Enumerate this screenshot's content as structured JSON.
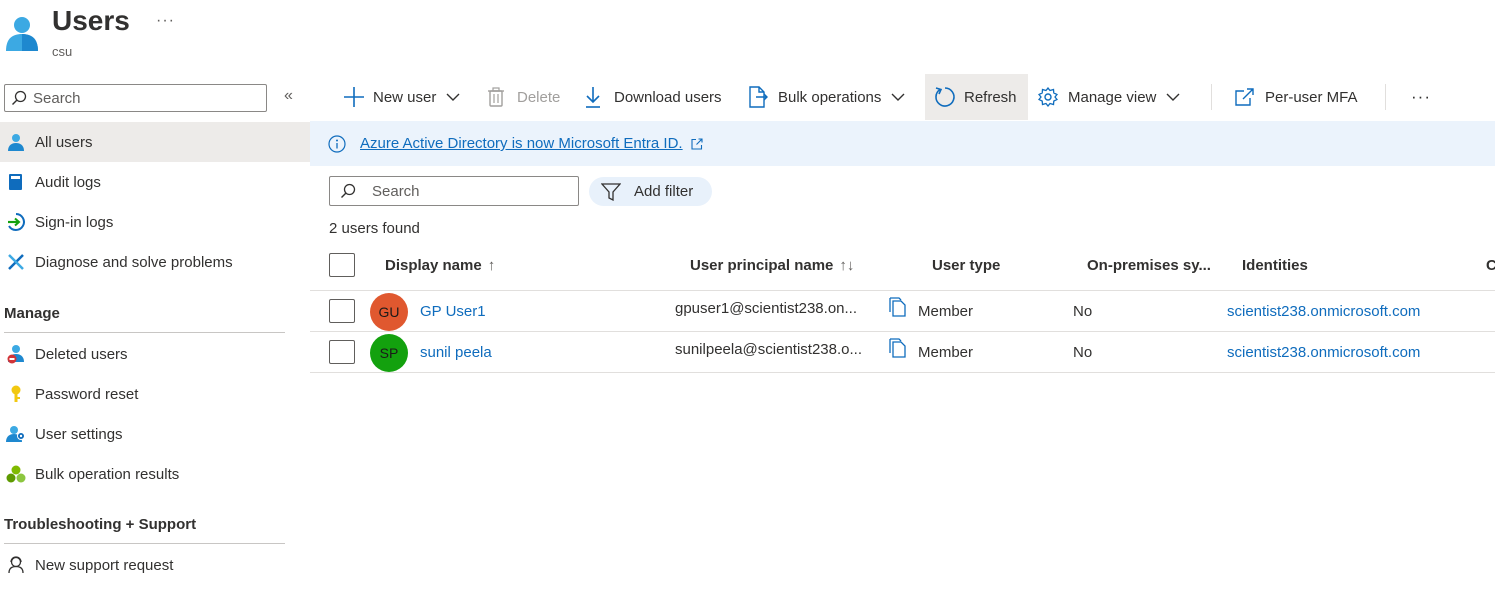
{
  "header": {
    "title": "Users",
    "subtitle": "csu",
    "more": "···"
  },
  "sidebar": {
    "search_placeholder": "Search",
    "collapse": "«",
    "items": [
      {
        "label": "All users",
        "icon": "user-icon"
      },
      {
        "label": "Audit logs",
        "icon": "book-icon"
      },
      {
        "label": "Sign-in logs",
        "icon": "sign-in-icon"
      },
      {
        "label": "Diagnose and solve problems",
        "icon": "wrench-icon"
      }
    ],
    "manage_title": "Manage",
    "manage_items": [
      {
        "label": "Deleted users",
        "icon": "deleted-user-icon"
      },
      {
        "label": "Password reset",
        "icon": "key-icon"
      },
      {
        "label": "User settings",
        "icon": "user-settings-icon"
      },
      {
        "label": "Bulk operation results",
        "icon": "bulk-results-icon"
      }
    ],
    "support_title": "Troubleshooting + Support",
    "support_items": [
      {
        "label": "New support request",
        "icon": "support-person-icon"
      }
    ]
  },
  "toolbar": {
    "new_user": "New user",
    "delete": "Delete",
    "download_users": "Download users",
    "bulk_operations": "Bulk operations",
    "refresh": "Refresh",
    "manage_view": "Manage view",
    "per_user_mfa": "Per-user MFA",
    "more": "···"
  },
  "banner": {
    "text": "Azure Active Directory is now Microsoft Entra ID."
  },
  "filters": {
    "search_placeholder": "Search",
    "add_filter": "Add filter",
    "result_count": "2 users found"
  },
  "table": {
    "columns": {
      "display_name": "Display name",
      "display_name_sort": "↑",
      "upn": "User principal name",
      "upn_sort": "↑↓",
      "user_type": "User type",
      "on_prem": "On-premises sy...",
      "identities": "Identities",
      "cut": "C"
    },
    "rows": [
      {
        "initials": "GU",
        "avatar_color": "#e0582f",
        "display_name": "GP User1",
        "upn": "gpuser1@scientist238.on...",
        "user_type": "Member",
        "on_prem": "No",
        "identities": "scientist238.onmicrosoft.com"
      },
      {
        "initials": "SP",
        "avatar_color": "#13a10e",
        "display_name": "sunil peela",
        "upn": "sunilpeela@scientist238.o...",
        "user_type": "Member",
        "on_prem": "No",
        "identities": "scientist238.onmicrosoft.com"
      }
    ]
  },
  "colors": {
    "accent": "#0f6cbd",
    "banner_bg": "#ebf3fc",
    "active_nav_bg": "#edebe9"
  }
}
